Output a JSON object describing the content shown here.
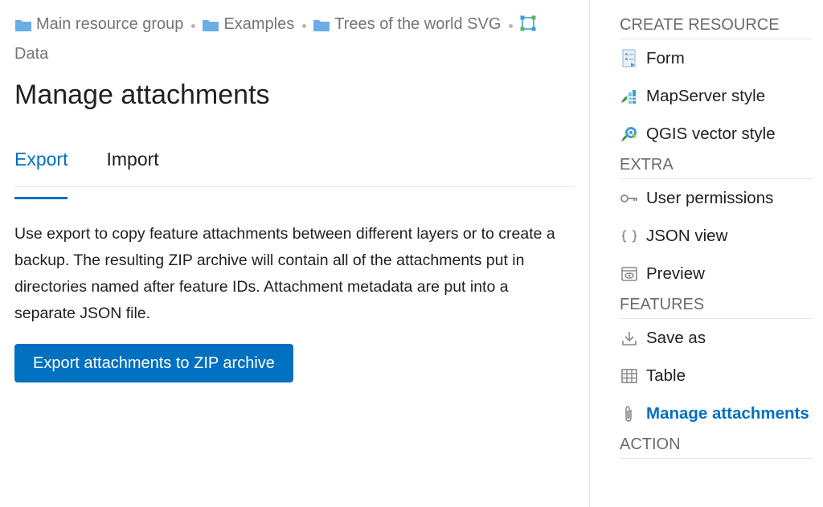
{
  "breadcrumb": {
    "items": [
      {
        "label": "Main resource group",
        "icon": "folder-icon"
      },
      {
        "label": "Examples",
        "icon": "folder-icon"
      },
      {
        "label": "Trees of the world SVG",
        "icon": "folder-icon"
      },
      {
        "label": "Data",
        "icon": "vector-layer-icon"
      }
    ]
  },
  "page": {
    "title": "Manage attachments"
  },
  "tabs": [
    {
      "label": "Export",
      "active": true
    },
    {
      "label": "Import",
      "active": false
    }
  ],
  "export": {
    "description": "Use export to copy feature attachments between different layers or to create a backup. The resulting ZIP archive will contain all of the attachments put in directories named after feature IDs. Attachment metadata are put into a separate JSON file.",
    "button_label": "Export attachments to ZIP archive"
  },
  "sidebar": {
    "sections": [
      {
        "title": "CREATE RESOURCE",
        "items": [
          {
            "label": "Form",
            "icon": "form-icon"
          },
          {
            "label": "MapServer style",
            "icon": "mapserver-style-icon"
          },
          {
            "label": "QGIS vector style",
            "icon": "qgis-style-icon"
          }
        ]
      },
      {
        "title": "EXTRA",
        "items": [
          {
            "label": "User permissions",
            "icon": "key-icon"
          },
          {
            "label": "JSON view",
            "icon": "braces-icon"
          },
          {
            "label": "Preview",
            "icon": "preview-icon"
          }
        ]
      },
      {
        "title": "FEATURES",
        "items": [
          {
            "label": "Save as",
            "icon": "download-icon"
          },
          {
            "label": "Table",
            "icon": "table-icon"
          },
          {
            "label": "Manage attachments",
            "icon": "paperclip-icon",
            "selected": true
          }
        ]
      },
      {
        "title": "ACTION",
        "items": []
      }
    ]
  },
  "colors": {
    "accent": "#0070c0",
    "folder": "#6aaee8",
    "muted": "#757575"
  }
}
